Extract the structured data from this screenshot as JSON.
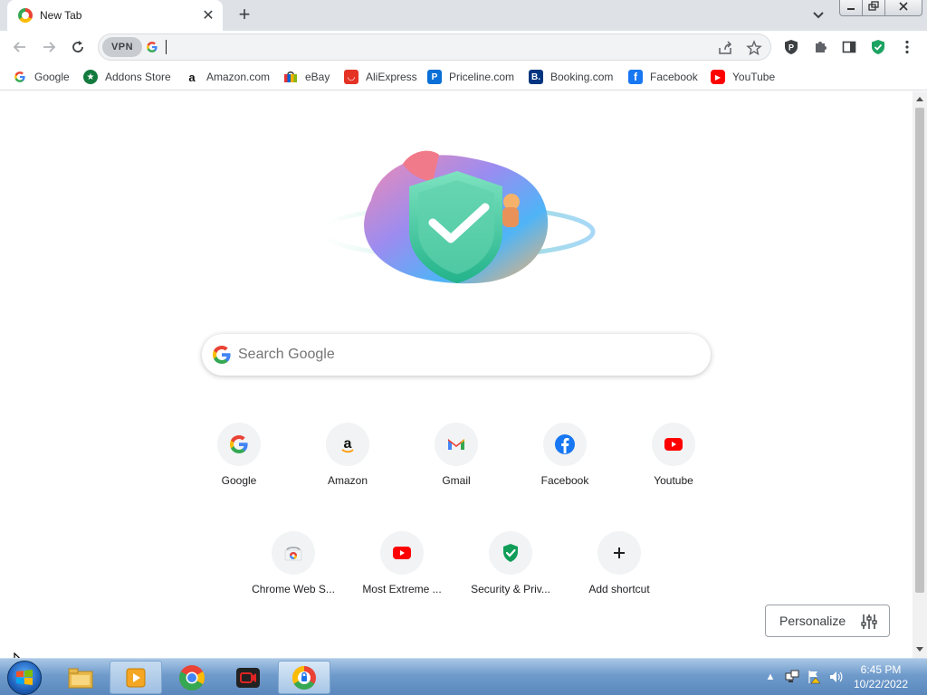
{
  "tab": {
    "title": "New Tab",
    "close_label": "✕"
  },
  "toolbar": {
    "vpn_label": "VPN",
    "omnibox_value": "",
    "omnibox_placeholder": ""
  },
  "bookmarks": [
    {
      "label": "Google",
      "icon": "google-icon"
    },
    {
      "label": "Addons Store",
      "icon": "addons-store-icon"
    },
    {
      "label": "Amazon.com",
      "icon": "amazon-icon"
    },
    {
      "label": "eBay",
      "icon": "ebay-icon"
    },
    {
      "label": "AliExpress",
      "icon": "aliexpress-icon"
    },
    {
      "label": "Priceline.com",
      "icon": "priceline-icon"
    },
    {
      "label": "Booking.com",
      "icon": "booking-icon"
    },
    {
      "label": "Facebook",
      "icon": "facebook-icon"
    },
    {
      "label": "YouTube",
      "icon": "youtube-icon"
    }
  ],
  "search": {
    "placeholder": "Search Google"
  },
  "shortcuts": [
    {
      "label": "Google",
      "icon": "google-icon"
    },
    {
      "label": "Amazon",
      "icon": "amazon-icon"
    },
    {
      "label": "Gmail",
      "icon": "gmail-icon"
    },
    {
      "label": "Facebook",
      "icon": "facebook-icon"
    },
    {
      "label": "Youtube",
      "icon": "youtube-icon"
    },
    {
      "label": "Chrome Web S...",
      "icon": "chrome-web-store-icon"
    },
    {
      "label": "Most Extreme ...",
      "icon": "youtube-icon"
    },
    {
      "label": "Security & Priv...",
      "icon": "shield-check-icon"
    },
    {
      "label": "Add shortcut",
      "icon": "plus-icon"
    }
  ],
  "personalize": {
    "label": "Personalize"
  },
  "taskbar": {
    "time": "6:45 PM",
    "date": "10/22/2022"
  },
  "colors": {
    "google_blue": "#4285f4",
    "google_red": "#ea4335",
    "google_yellow": "#fbbc05",
    "google_green": "#34a853",
    "youtube_red": "#ff0000",
    "facebook_blue": "#1877f2",
    "shield_green": "#0f9d58"
  }
}
